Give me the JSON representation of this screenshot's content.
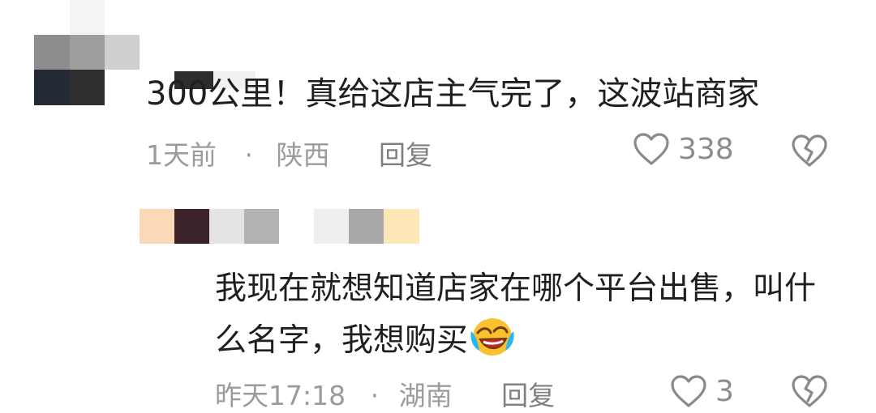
{
  "comments": [
    {
      "text": "300公里！真给这店主气完了，这波站商家",
      "time": "1天前",
      "separator": "·",
      "location": "陕西",
      "reply_label": "回复",
      "like_count": "338"
    },
    {
      "text": "我现在就想知道店家在哪个平台出售，叫什么名字，我想购买",
      "emoji": "laughing-crying-face",
      "time": "昨天17:18",
      "separator": "·",
      "location": "湖南",
      "reply_label": "回复",
      "like_count": "3"
    }
  ],
  "colors": {
    "text": "#1f1f1f",
    "meta": "#9b9b9b",
    "reply": "#7f7f7f"
  }
}
